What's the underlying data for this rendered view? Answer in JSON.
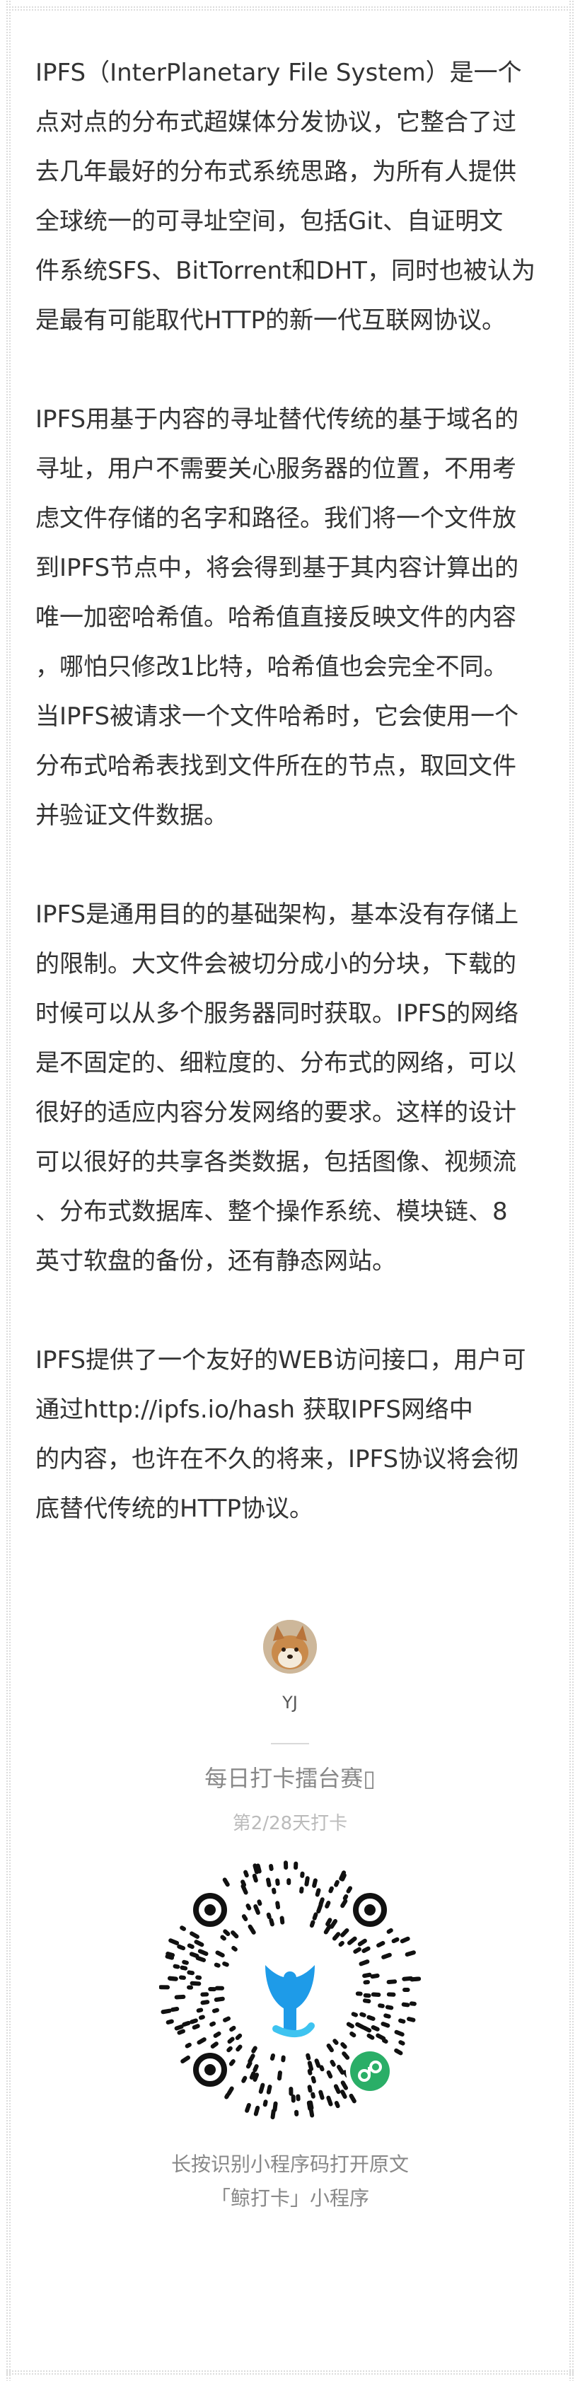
{
  "article": {
    "paragraphs": [
      "IPFS（InterPlanetary File System）是一个\n点对点的分布式超媒体分发协议，它整合了过\n去几年最好的分布式系统思路，为所有人提供\n全球统一的可寻址空间，包括Git、自证明文\n件系统SFS、BitTorrent和DHT，同时也被认为\n是最有可能取代HTTP的新一代互联网协议。",
      "IPFS用基于内容的寻址替代传统的基于域名的\n寻址，用户不需要关心服务器的位置，不用考\n虑文件存储的名字和路径。我们将一个文件放\n到IPFS节点中，将会得到基于其内容计算出的\n唯一加密哈希值。哈希值直接反映文件的内容\n，哪怕只修改1比特，哈希值也会完全不同。\n当IPFS被请求一个文件哈希时，它会使用一个\n分布式哈希表找到文件所在的节点，取回文件\n并验证文件数据。",
      "IPFS是通用目的的基础架构，基本没有存储上\n的限制。大文件会被切分成小的分块，下载的\n时候可以从多个服务器同时获取。IPFS的网络\n是不固定的、细粒度的、分布式的网络，可以\n很好的适应内容分发网络的要求。这样的设计\n可以很好的共享各类数据，包括图像、视频流\n、分布式数据库、整个操作系统、模块链、8\n英寸软盘的备份，还有静态网站。",
      "IPFS提供了一个友好的WEB访问接口，用户可\n通过http://ipfs.io/hash 获取IPFS网络中\n的内容，也许在不久的将来，IPFS协议将会彻\n底替代传统的HTTP协议。"
    ]
  },
  "footer": {
    "username": "YJ",
    "event_title": "每日打卡擂台赛▯",
    "event_progress": "第2/28天打卡",
    "qr_caption_line1": "长按识别小程序码打开原文",
    "qr_caption_line2": "「鲸打卡」小程序",
    "icons": {
      "avatar": "shiba-dog-avatar",
      "qr": "mini-program-qr-code",
      "badge": "mini-program-icon"
    }
  },
  "colors": {
    "body_text": "#333333",
    "muted_text": "#888888",
    "light_text": "#bbbbbb",
    "qr_logo": "#1e9be8",
    "qr_badge": "#2aae67"
  }
}
